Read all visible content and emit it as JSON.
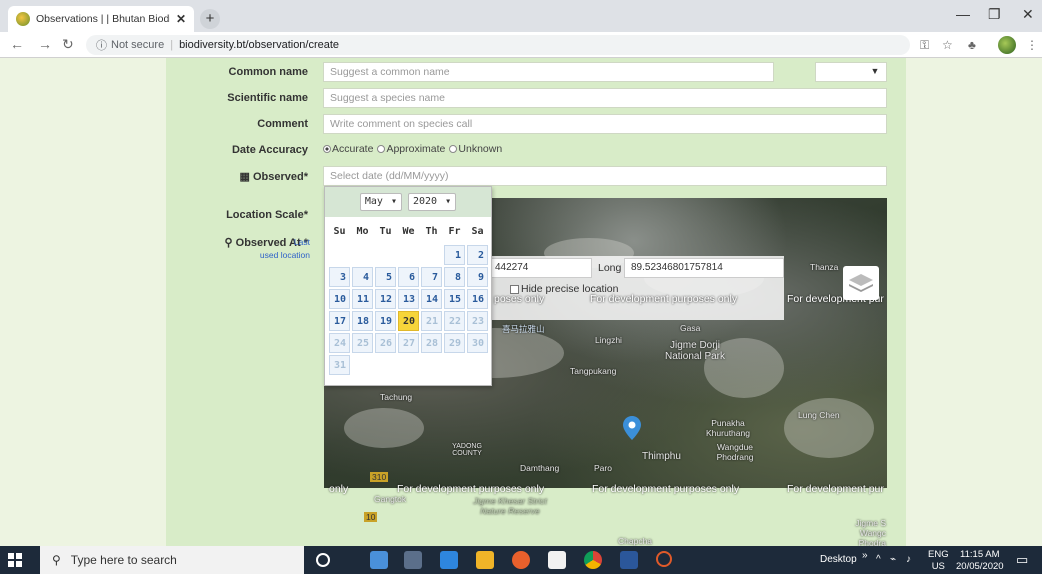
{
  "browser": {
    "tab_title": "Observations | | Bhutan Biodivers",
    "tab_close": "✕",
    "new_tab": "+",
    "security": "Not secure",
    "url": "biodiversity.bt/observation/create"
  },
  "form": {
    "common_name_label": "Common name",
    "common_name_placeholder": "Suggest a common name",
    "scientific_name_label": "Scientific name",
    "scientific_name_placeholder": "Suggest a species name",
    "comment_label": "Comment",
    "comment_placeholder": "Write comment on species call",
    "date_accuracy_label": "Date Accuracy",
    "date_accuracy_options": [
      "Accurate",
      "Approximate",
      "Unknown"
    ],
    "date_accuracy_selected": "Accurate",
    "observed_label": "Observed*",
    "observed_placeholder": "Select date (dd/MM/yyyy)",
    "location_scale_label": "Location Scale*",
    "observed_at_label": "Observed At *",
    "last_used_prefix": "Last",
    "last_used_suffix": "used location",
    "clear_button": "✕"
  },
  "datepicker": {
    "month": "May",
    "year": "2020",
    "weekdays": [
      "Su",
      "Mo",
      "Tu",
      "We",
      "Th",
      "Fr",
      "Sa"
    ],
    "today": "20"
  },
  "map": {
    "lat_value": "442274",
    "long_label": "Long",
    "long_value": "89.52346801757814",
    "hide_precise": "Hide precise location",
    "dev_text": "For development purposes only",
    "dev_text_partial1": "poses only",
    "dev_text_partial2": "For development pur",
    "dev_text_partial3": "only",
    "place_labels": {
      "thanza": "Thanza",
      "gasa": "Gasa",
      "jigme_dorji": "Jigme Dorji National Park",
      "punakha": "Punakha Khuruthang",
      "wangdue": "Wangdue Phodrang",
      "thimphu": "Thimphu",
      "paro": "Paro",
      "damthang": "Damthang",
      "yadong": "YADONG COUNTY",
      "lung_chen": "Lung Chen",
      "gangtok": "Gangtok",
      "chapcha": "Chapcha",
      "jigme_khesar": "Jigme Khesar Strict Nature Reserve",
      "jigme_s": "Jigme S Wangc Phodra",
      "lingzhi": "Lingzhi",
      "tachung": "Tachung",
      "kangpumkang": "Tangpukang",
      "tibet_label": "喜马拉雅山",
      "road_310": "310",
      "road_10": "10"
    }
  },
  "taskbar": {
    "search_placeholder": "Type here to search",
    "desktop": "Desktop",
    "lang_line1": "ENG",
    "lang_line2": "US",
    "time": "11:15 AM",
    "date": "20/05/2020"
  },
  "colors": {
    "page_bg": "#edf4e1",
    "form_bg": "#d8ecc8",
    "today": "#f7d53a",
    "taskbar": "#1d2a3a"
  }
}
